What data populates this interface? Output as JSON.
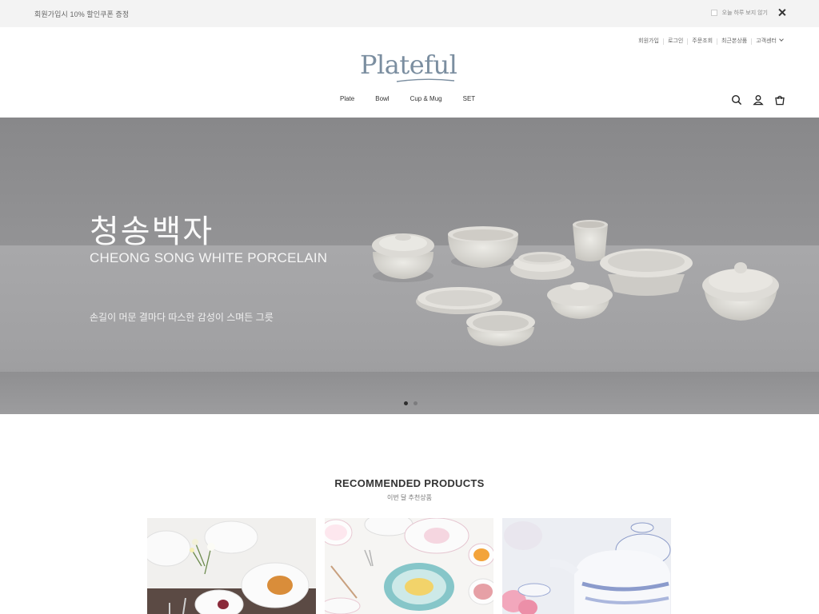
{
  "promo": {
    "text": "회원가입시 10% 할인쿠폰 증정",
    "hide_today_label": "오늘 하루 보지 않기"
  },
  "util_links": [
    "회원가입",
    "로그인",
    "주문조회",
    "최근본상품",
    "고객센터"
  ],
  "brand": {
    "logo_text": "Plateful",
    "color": "#7b8ea0"
  },
  "nav": {
    "items": [
      "Plate",
      "Bowl",
      "Cup & Mug",
      "SET"
    ],
    "icons": [
      "search-icon",
      "user-icon",
      "cart-icon"
    ]
  },
  "hero": {
    "title": "청송백자",
    "subtitle": "CHEONG SONG WHITE PORCELAIN",
    "description": "손길이 머문 결마다 따스한 감성이 스며든 그릇",
    "slides_total": 2,
    "active_slide": 1
  },
  "recommended": {
    "title": "RECOMMENDED PRODUCTS",
    "subtitle": "이번 달 추천상품"
  }
}
